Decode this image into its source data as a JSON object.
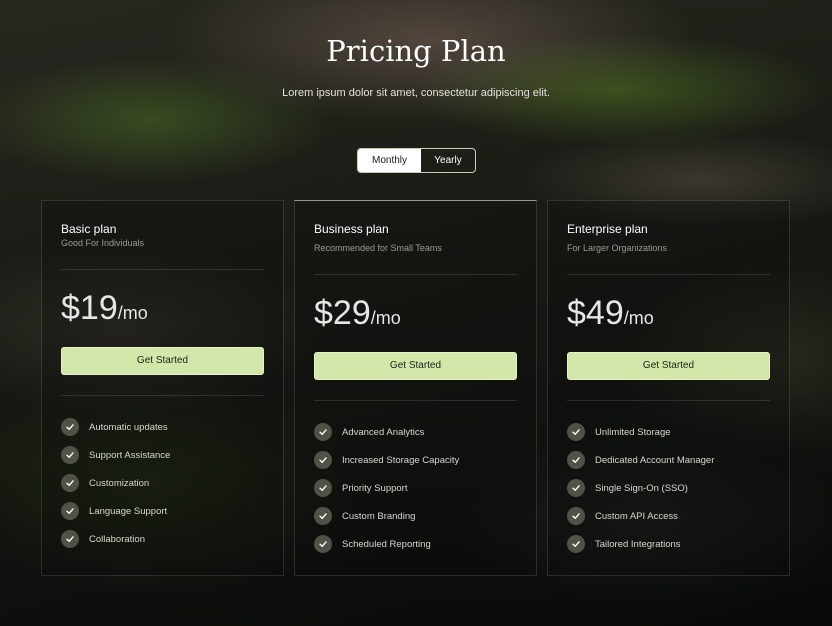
{
  "header": {
    "title": "Pricing Plan",
    "subtitle": "Lorem ipsum dolor sit amet, consectetur adipiscing elit."
  },
  "billing_toggle": {
    "options": [
      "Monthly",
      "Yearly"
    ],
    "selected": "Monthly"
  },
  "plans": [
    {
      "name": "Basic plan",
      "description": "Good For Individuals",
      "price": "$19",
      "period": "/mo",
      "cta": "Get Started",
      "features": [
        "Automatic updates",
        "Support Assistance",
        "Customization",
        "Language Support",
        "Collaboration"
      ]
    },
    {
      "name": "Business plan",
      "description": "Recommended for Small Teams",
      "price": "$29",
      "period": "/mo",
      "cta": "Get Started",
      "features": [
        "Advanced Analytics",
        "Increased Storage Capacity",
        "Priority Support",
        "Custom Branding",
        "Scheduled Reporting"
      ]
    },
    {
      "name": "Enterprise plan",
      "description": "For Larger Organizations",
      "price": "$49",
      "period": "/mo",
      "cta": "Get Started",
      "features": [
        "Unlimited Storage",
        "Dedicated Account Manager",
        "Single Sign-On (SSO)",
        "Custom API Access",
        "Tailored Integrations"
      ]
    }
  ],
  "icons": {
    "feature_check": "check-icon"
  },
  "colors": {
    "accent": "#d3e7ab",
    "check_bg": "#505247",
    "toggle_active_bg": "#ffffff"
  }
}
